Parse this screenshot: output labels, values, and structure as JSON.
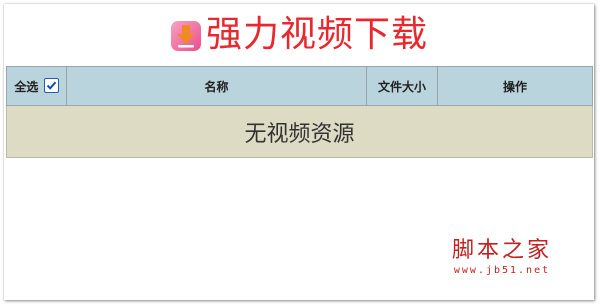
{
  "app": {
    "title": "强力视频下载",
    "logo_icon": "download-arrow-icon"
  },
  "table": {
    "select_all_label": "全选",
    "select_all_checked": true,
    "columns": [
      "名称",
      "文件大小",
      "操作"
    ],
    "empty_message": "无视频资源"
  },
  "watermark": {
    "name": "脚本之家",
    "url": "www.jb51.net"
  },
  "colors": {
    "title": "#e8282e",
    "header_bg": "#b9d4dc",
    "empty_row_bg": "#dedbc5",
    "watermark": "#c4201f"
  }
}
